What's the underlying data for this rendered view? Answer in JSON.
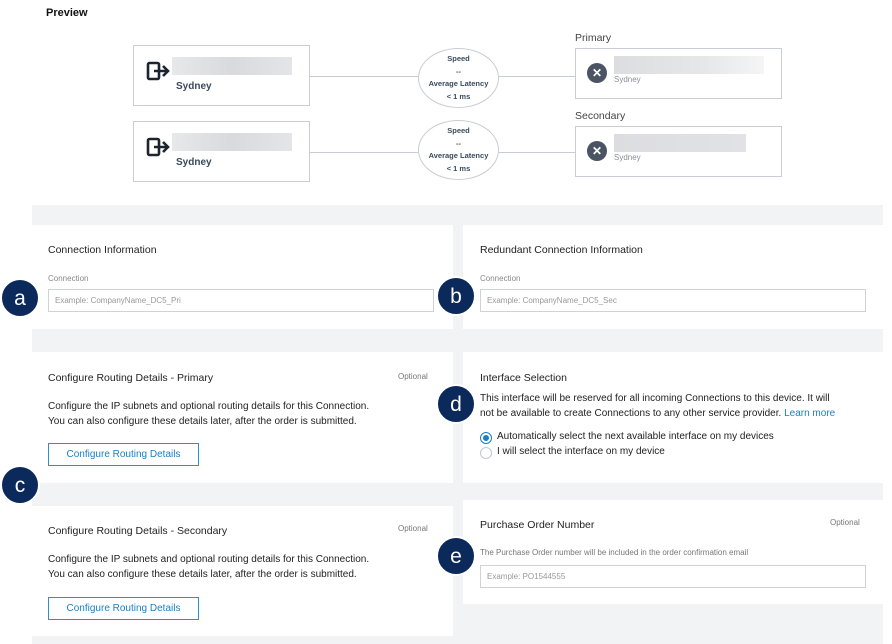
{
  "preview": {
    "title": "Preview",
    "connections": [
      {
        "source_city": "Sydney",
        "speed_label": "Speed",
        "speed_value": "--",
        "latency_label": "Average Latency",
        "latency_value": "< 1 ms",
        "dest_label": "Primary",
        "dest_city": "Sydney",
        "icons": {
          "source": "port-exit-icon",
          "dest": "provider-x-icon"
        }
      },
      {
        "source_city": "Sydney",
        "speed_label": "Speed",
        "speed_value": "--",
        "latency_label": "Average Latency",
        "latency_value": "< 1 ms",
        "dest_label": "Secondary",
        "dest_city": "Sydney",
        "icons": {
          "source": "port-exit-icon",
          "dest": "provider-x-icon"
        }
      }
    ]
  },
  "connection_info": {
    "title": "Connection Information",
    "field_label": "Connection",
    "placeholder": "Example: CompanyName_DC5_Pri"
  },
  "redundant_info": {
    "title": "Redundant Connection Information",
    "field_label": "Connection",
    "placeholder": "Example: CompanyName_DC5_Sec"
  },
  "routing_primary": {
    "title": "Configure Routing Details - Primary",
    "optional": "Optional",
    "line1": "Configure the IP subnets and optional routing details for this Connection.",
    "line2": "You can also configure these details later, after the order is submitted.",
    "button": "Configure Routing Details"
  },
  "routing_secondary": {
    "title": "Configure Routing Details - Secondary",
    "optional": "Optional",
    "line1": "Configure the IP subnets and optional routing details for this Connection.",
    "line2": "You can also configure these details later, after the order is submitted.",
    "button": "Configure Routing Details"
  },
  "interface": {
    "title": "Interface Selection",
    "line1": "This interface will be reserved for all incoming Connections to this device. It will",
    "line2": "not be available to create Connections to any other service provider.",
    "learn_more": "Learn more",
    "option_auto": "Automatically select the next available interface on my devices",
    "option_manual": "I will select the interface on my device",
    "selected": "auto"
  },
  "purchase_order": {
    "title": "Purchase Order Number",
    "optional": "Optional",
    "description": "The Purchase Order number will be included in the order confirmation email",
    "placeholder": "Example: PO1544555"
  },
  "callouts": {
    "a": "a",
    "b": "b",
    "c": "c",
    "d": "d",
    "e": "e"
  },
  "colors": {
    "accent": "#1a7fc4",
    "callout": "#0b2a5b",
    "icon_dark": "#4a5462",
    "panel_bg": "#f2f3f5"
  }
}
